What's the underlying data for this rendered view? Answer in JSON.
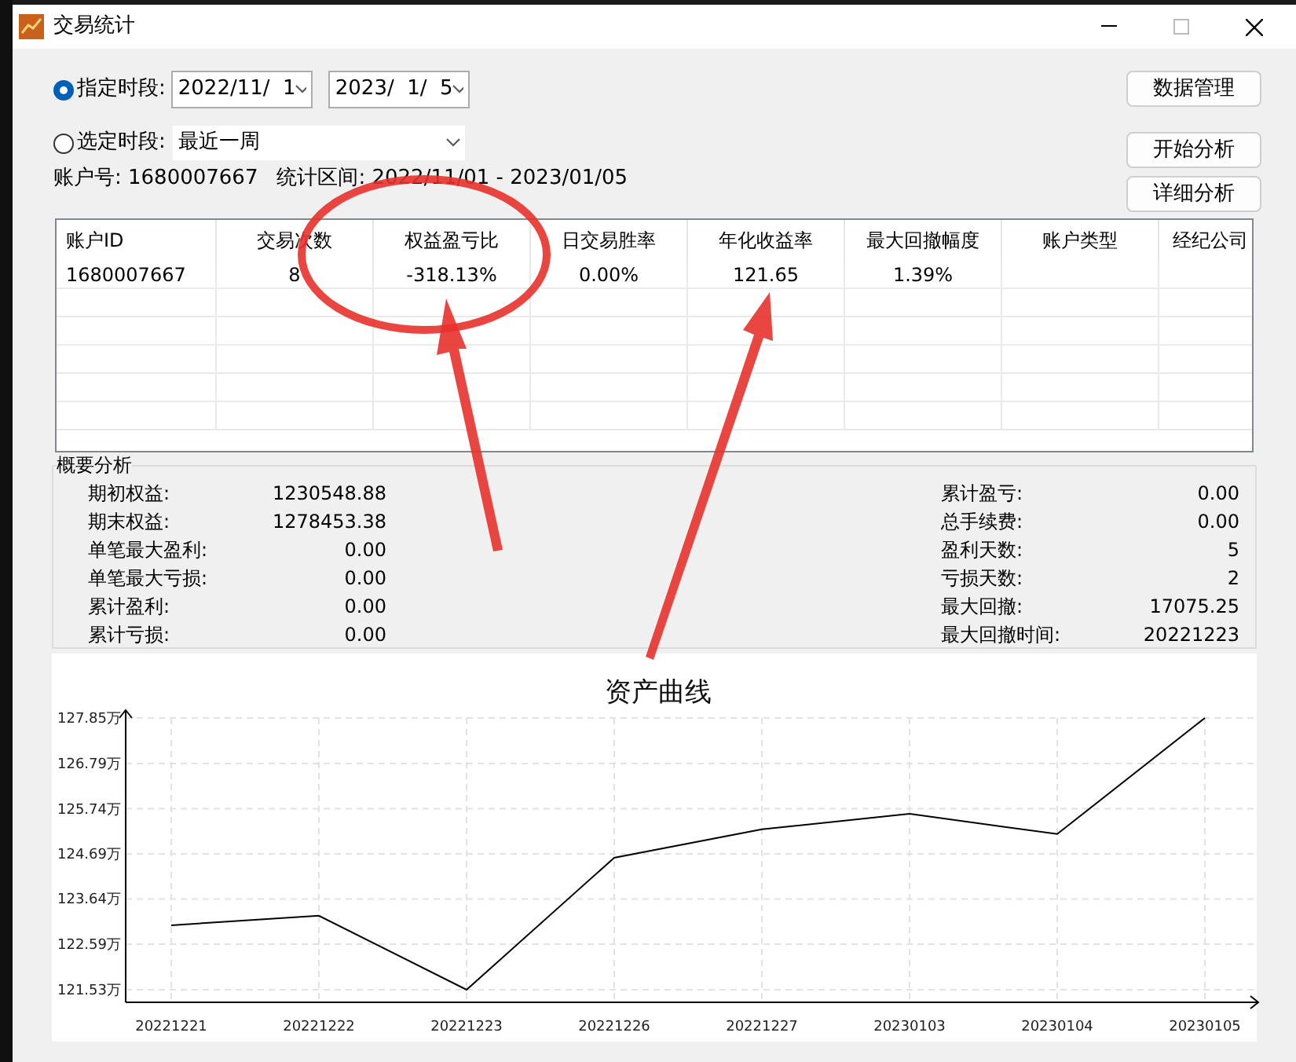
{
  "window": {
    "title": "交易统计"
  },
  "period_options": [
    {
      "label": "指定时段:",
      "selected": true,
      "kind": "range",
      "from": "2022/11/  1",
      "to": "2023/  1/  5"
    },
    {
      "label": "选定时段:",
      "selected": false,
      "kind": "preset",
      "value": "最近一周"
    }
  ],
  "buttons": [
    "数据管理",
    "开始分析",
    "详细分析"
  ],
  "info": [
    {
      "label": "账户号:",
      "value": "1680007667"
    },
    {
      "label": "统计区间:",
      "value": "2022/11/01 - 2023/01/05"
    }
  ],
  "table": {
    "columns": [
      "账户ID",
      "交易次数",
      "权益盈亏比",
      "日交易胜率",
      "年化收益率",
      "最大回撤幅度",
      "账户类型",
      "经纪公司"
    ],
    "rows": [
      [
        "1680007667",
        "8",
        "-318.13%",
        "0.00%",
        "121.65",
        "1.39%",
        "",
        ""
      ]
    ]
  },
  "summary": {
    "title": "概要分析",
    "left": [
      {
        "label": "期初权益:",
        "value": "1230548.88"
      },
      {
        "label": "期末权益:",
        "value": "1278453.38"
      },
      {
        "label": "单笔最大盈利:",
        "value": "0.00"
      },
      {
        "label": "单笔最大亏损:",
        "value": "0.00"
      },
      {
        "label": "累计盈利:",
        "value": "0.00"
      },
      {
        "label": "累计亏损:",
        "value": "0.00"
      }
    ],
    "right": [
      {
        "label": "累计盈亏:",
        "value": "0.00"
      },
      {
        "label": "总手续费:",
        "value": "0.00"
      },
      {
        "label": "盈利天数:",
        "value": "5"
      },
      {
        "label": "亏损天数:",
        "value": "2"
      },
      {
        "label": "最大回撤:",
        "value": "17075.25"
      },
      {
        "label": "最大回撤时间:",
        "value": "20221223"
      }
    ]
  },
  "chart_data": {
    "type": "line",
    "title": "资产曲线",
    "categories": [
      "20221221",
      "20221222",
      "20221223",
      "20221226",
      "20221227",
      "20230103",
      "20230104",
      "20230105"
    ],
    "grid": true,
    "series": [
      {
        "color": "#000000",
        "values": [
          123.03,
          123.25,
          121.53,
          124.6,
          125.26,
          125.62,
          125.15,
          127.85
        ]
      }
    ],
    "ylim": [
      121.53,
      127.85
    ],
    "yticks": [
      {
        "value": 121.53,
        "label": "121.53万"
      },
      {
        "value": 122.59,
        "label": "122.59万"
      },
      {
        "value": 123.64,
        "label": "123.64万"
      },
      {
        "value": 124.69,
        "label": "124.69万"
      },
      {
        "value": 125.74,
        "label": "125.74万"
      },
      {
        "value": 126.79,
        "label": "126.79万"
      },
      {
        "value": 127.85,
        "label": "127.85万"
      }
    ]
  }
}
